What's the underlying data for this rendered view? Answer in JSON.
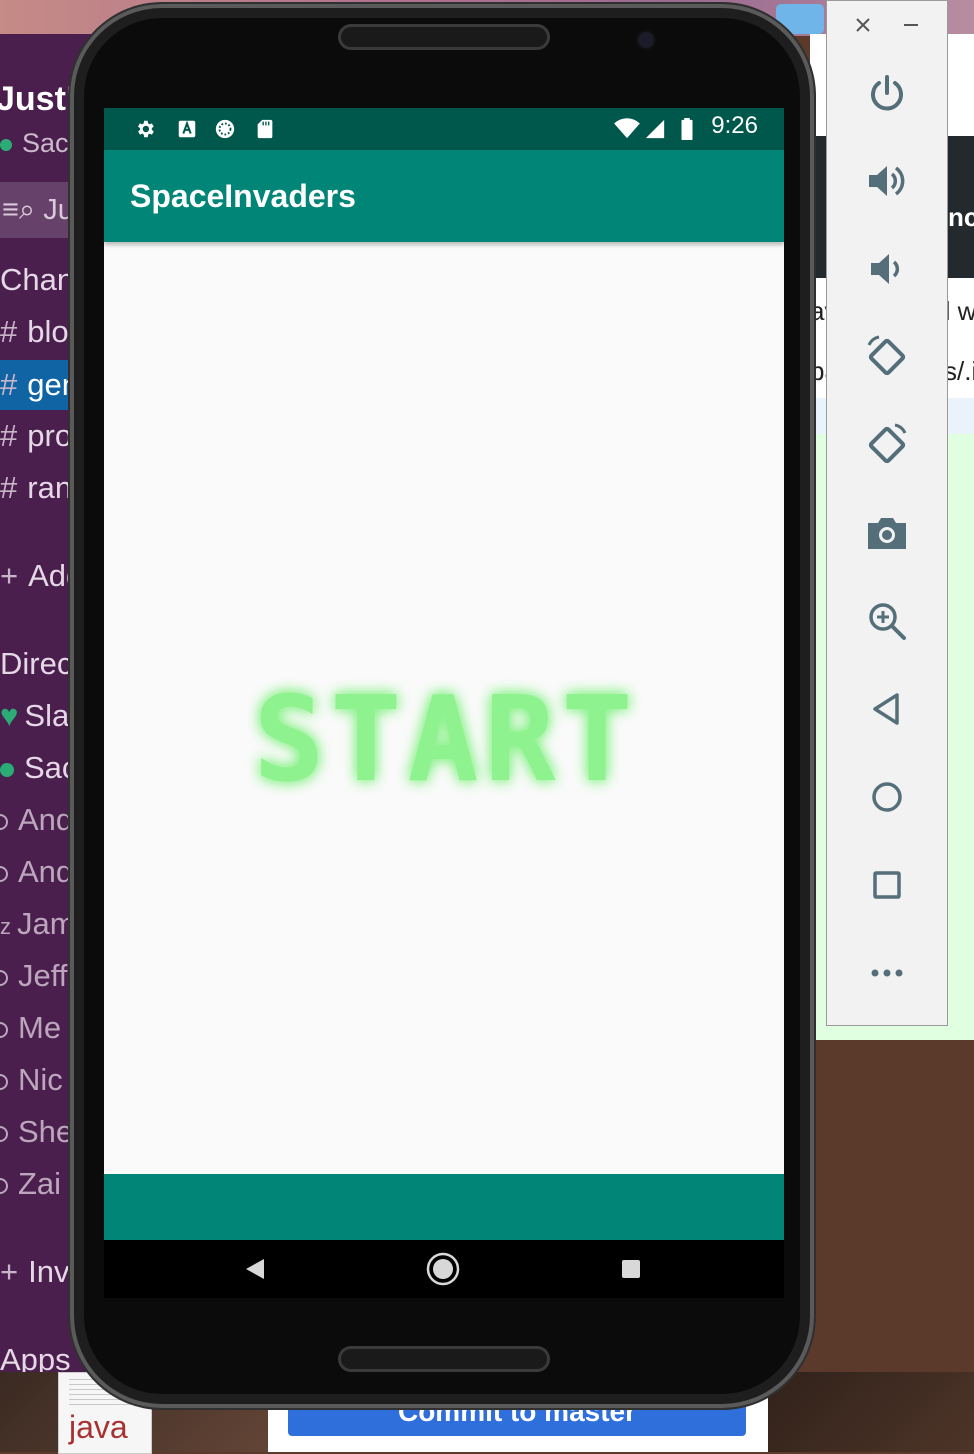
{
  "slack": {
    "workspace": "JustB",
    "status_user": "Sacl",
    "jump_label": "Ju",
    "channels_header": "Chann",
    "channels": [
      {
        "label": "blo"
      },
      {
        "label": "gen",
        "selected": true
      },
      {
        "label": "pro"
      },
      {
        "label": "ran"
      }
    ],
    "add_channel": "Add",
    "dm_header": "Direct",
    "dms": [
      {
        "label": "Slac",
        "presence": "heart"
      },
      {
        "label": "Sac",
        "presence": "online"
      },
      {
        "label": "And",
        "presence": "offline"
      },
      {
        "label": "And",
        "presence": "offline"
      },
      {
        "label": "Jam",
        "presence": "away"
      },
      {
        "label": "Jeff",
        "presence": "offline"
      },
      {
        "label": "Me",
        "presence": "offline"
      },
      {
        "label": "Nic",
        "presence": "offline"
      },
      {
        "label": "She",
        "presence": "offline"
      },
      {
        "label": "Zai",
        "presence": "offline"
      }
    ],
    "invite": "Invi",
    "apps": "Apps"
  },
  "background": {
    "right_fragments": [
      "nc",
      "av",
      "d w",
      "ba",
      "s/.i"
    ],
    "commit_button": "Commit to master",
    "java_file": "java"
  },
  "phone": {
    "status_time": "9:26",
    "status_icons": [
      "settings-icon",
      "keyboard-a-icon",
      "sync-icon",
      "sd-card-icon",
      "wifi-icon",
      "signal-icon",
      "battery-icon"
    ],
    "app_title": "SpaceInvaders",
    "start_text": "START",
    "start_color": "#8ef28e",
    "nav": [
      "back-nav-icon",
      "home-nav-icon",
      "recents-nav-icon"
    ]
  },
  "emulator": {
    "window_controls": [
      "close-icon",
      "minimize-icon"
    ],
    "tools": [
      "power-icon",
      "volume-up-icon",
      "volume-down-icon",
      "rotate-left-icon",
      "rotate-right-icon",
      "camera-icon",
      "zoom-icon",
      "back-icon",
      "home-icon",
      "overview-icon",
      "more-icon"
    ]
  },
  "colors": {
    "primary": "#008577",
    "primary_dark": "#00574b",
    "slack_purple": "#4b1f4d",
    "slack_selected": "#1164a3"
  }
}
